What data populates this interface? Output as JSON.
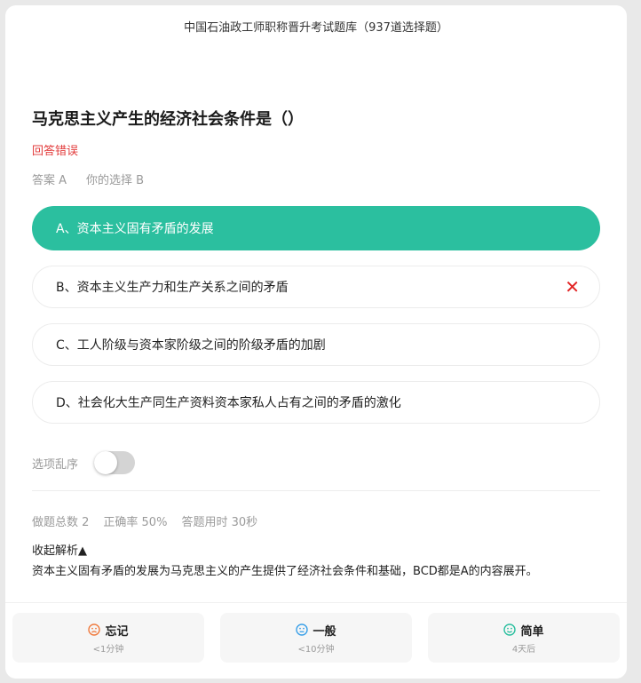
{
  "header": {
    "title": "中国石油政工师职称晋升考试题库（937道选择题）"
  },
  "question": {
    "text": "马克思主义产生的经济社会条件是（）",
    "result": "回答错误",
    "answer_label": "答案 A",
    "choice_label": "你的选择 B"
  },
  "options": [
    {
      "text": "A、资本主义固有矛盾的发展",
      "state": "correct"
    },
    {
      "text": "B、资本主义生产力和生产关系之间的矛盾",
      "state": "wrong"
    },
    {
      "text": "C、工人阶级与资本家阶级之间的阶级矛盾的加剧",
      "state": "normal"
    },
    {
      "text": "D、社会化大生产同生产资料资本家私人占有之间的矛盾的激化",
      "state": "normal"
    }
  ],
  "shuffle": {
    "label": "选项乱序",
    "enabled": false
  },
  "stats": {
    "total": "做题总数 2",
    "accuracy": "正确率 50%",
    "time": "答题用时 30秒"
  },
  "analysis": {
    "toggle_label": "收起解析▲",
    "text": "资本主义固有矛盾的发展为马克思主义的产生提供了经济社会条件和基础，BCD都是A的内容展开。"
  },
  "rating": [
    {
      "label": "忘记",
      "sub": "<1分钟",
      "icon": "sad-face-icon",
      "color": "#f07b3f"
    },
    {
      "label": "一般",
      "sub": "<10分钟",
      "icon": "neutral-face-icon",
      "color": "#3aa0e8"
    },
    {
      "label": "简单",
      "sub": "4天后",
      "icon": "happy-face-icon",
      "color": "#2bbf9f"
    }
  ],
  "colors": {
    "correct": "#2bbf9f",
    "wrong": "#e23b3b",
    "muted": "#9a9a9a"
  }
}
